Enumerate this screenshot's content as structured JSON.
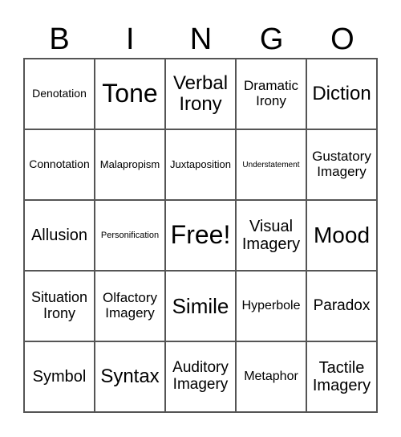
{
  "header": [
    "B",
    "I",
    "N",
    "G",
    "O"
  ],
  "cells": [
    [
      "Denotation",
      "Tone",
      "Verbal Irony",
      "Dramatic Irony",
      "Diction"
    ],
    [
      "Connotation",
      "Malapropism",
      "Juxtaposition",
      "Understatement",
      "Gustatory Imagery"
    ],
    [
      "Allusion",
      "Personification",
      "Free!",
      "Visual Imagery",
      "Mood"
    ],
    [
      "Situation Irony",
      "Olfactory Imagery",
      "Simile",
      "Hyperbole",
      "Paradox"
    ],
    [
      "Symbol",
      "Syntax",
      "Auditory Imagery",
      "Metaphor",
      "Tactile Imagery"
    ]
  ]
}
